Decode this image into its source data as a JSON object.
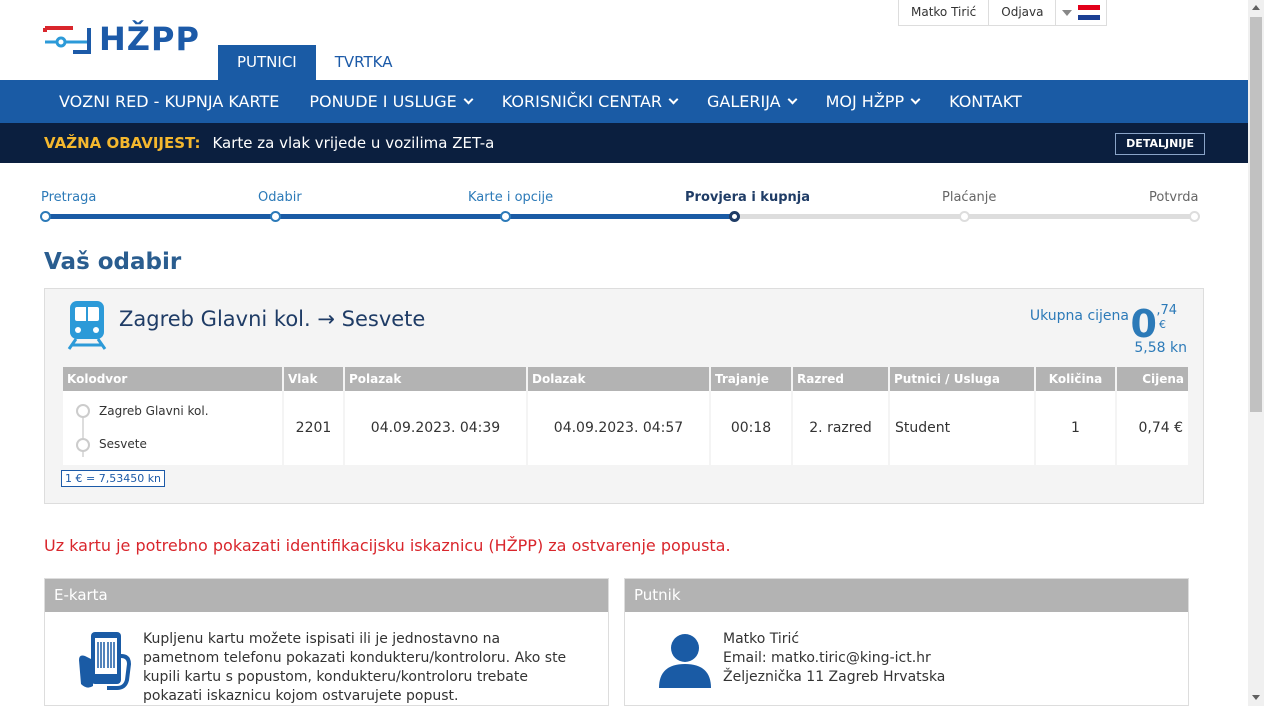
{
  "header": {
    "logo_text": "HŽPP",
    "tabs": [
      "PUTNICI",
      "TVRTKA"
    ],
    "user_name": "Matko Tirić",
    "logout_label": "Odjava",
    "language_flag": "croatian-flag-icon"
  },
  "nav": {
    "items": [
      {
        "label": "VOZNI RED - KUPNJA KARTE",
        "has_dropdown": false
      },
      {
        "label": "PONUDE I USLUGE",
        "has_dropdown": true
      },
      {
        "label": "KORISNIČKI CENTAR",
        "has_dropdown": true
      },
      {
        "label": "GALERIJA",
        "has_dropdown": true
      },
      {
        "label": "MOJ HŽPP",
        "has_dropdown": true
      },
      {
        "label": "KONTAKT",
        "has_dropdown": false
      }
    ]
  },
  "notice": {
    "label": "VAŽNA OBAVIJEST:",
    "text": "Karte za vlak vrijede u vozilima ZET-a",
    "button": "DETALJNIJE"
  },
  "steps": {
    "labels": [
      "Pretraga",
      "Odabir",
      "Karte i opcije",
      "Provjera i kupnja",
      "Plaćanje",
      "Potvrda"
    ],
    "current_index": 3
  },
  "title": "Vaš odabir",
  "selection": {
    "route": "Zagreb Glavni kol. → Sesvete",
    "total_label": "Ukupna cijena",
    "total_whole": "0",
    "total_decimal": ",74",
    "total_currency": "€",
    "total_kn": "5,58 kn",
    "headers": [
      "Kolodvor",
      "Vlak",
      "Polazak",
      "Dolazak",
      "Trajanje",
      "Razred",
      "Putnici / Usluga",
      "Količina",
      "Cijena"
    ],
    "row": {
      "from": "Zagreb Glavni kol.",
      "to": "Sesvete",
      "train": "2201",
      "departure": "04.09.2023. 04:39",
      "arrival": "04.09.2023. 04:57",
      "duration": "00:18",
      "class": "2. razred",
      "passenger": "Student",
      "quantity": "1",
      "price": "0,74 €"
    },
    "rate": "1 € = 7,53450 kn"
  },
  "warning": "Uz kartu je potrebno pokazati identifikacijsku iskaznicu (HŽPP) za ostvarenje popusta.",
  "ekarta": {
    "title": "E-karta",
    "text": "Kupljenu kartu možete ispisati ili je jednostavno na pametnom telefonu pokazati kondukteru/kontroloru. Ako ste kupili kartu s popustom, kondukteru/kontroloru trebate pokazati iskaznicu kojom ostvarujete popust."
  },
  "putnik": {
    "title": "Putnik",
    "name": "Matko Tirić",
    "email": "Email: matko.tiric@king-ict.hr",
    "address": "Željeznička 11 Zagreb Hrvatska"
  },
  "colors": {
    "brand_blue": "#1a5ba5",
    "notice_bg": "#0b1f3f",
    "notice_label": "#f5b82e",
    "warning_red": "#d9262c"
  }
}
